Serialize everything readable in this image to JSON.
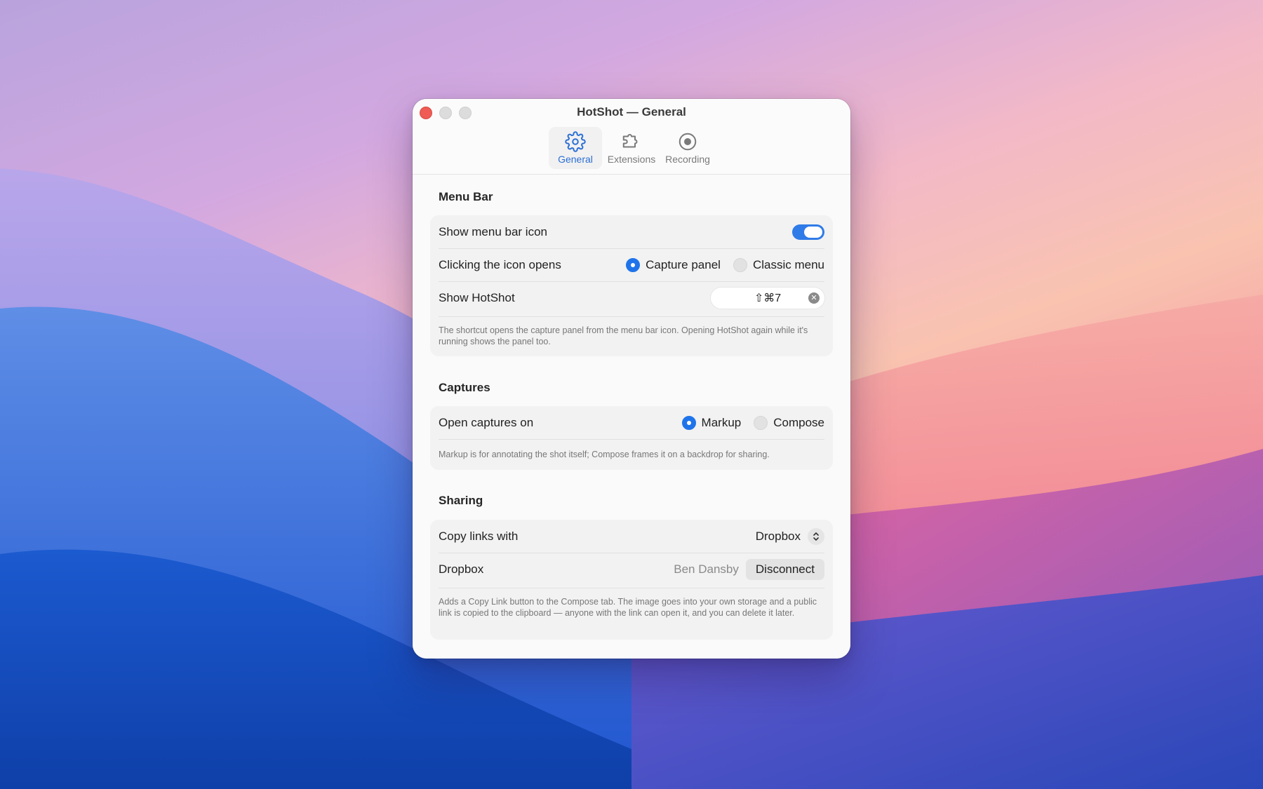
{
  "window": {
    "title": "HotShot — General"
  },
  "tabs": [
    {
      "label": "General",
      "icon": "gear-icon",
      "active": true
    },
    {
      "label": "Extensions",
      "icon": "puzzle-icon",
      "active": false
    },
    {
      "label": "Recording",
      "icon": "record-icon",
      "active": false
    }
  ],
  "menu_bar": {
    "title": "Menu Bar",
    "show_icon_label": "Show menu bar icon",
    "show_icon_enabled": true,
    "click_label": "Clicking the icon opens",
    "click_options": [
      "Capture panel",
      "Classic menu"
    ],
    "click_selected": "Capture panel",
    "shortcut_label": "Show HotShot",
    "shortcut_value": "⇧⌘7",
    "note": "The shortcut opens the capture panel from the menu bar icon. Opening HotShot again while it's running shows the panel too."
  },
  "captures": {
    "title": "Captures",
    "open_label": "Open captures on",
    "options": [
      "Markup",
      "Compose"
    ],
    "selected": "Markup",
    "note": "Markup is for annotating the shot itself; Compose frames it on a backdrop for sharing."
  },
  "sharing": {
    "title": "Sharing",
    "copy_label": "Copy links with",
    "copy_value": "Dropbox",
    "dropbox_label": "Dropbox",
    "account_name": "Ben Dansby",
    "disconnect_label": "Disconnect",
    "note": "Adds a Copy Link button to the Compose tab. The image goes into your own storage and a public link is copied to the clipboard — anyone with the link can open it, and you can delete it later."
  },
  "colors": {
    "accent": "#1f74ea",
    "close_button": "#ee5c55"
  }
}
